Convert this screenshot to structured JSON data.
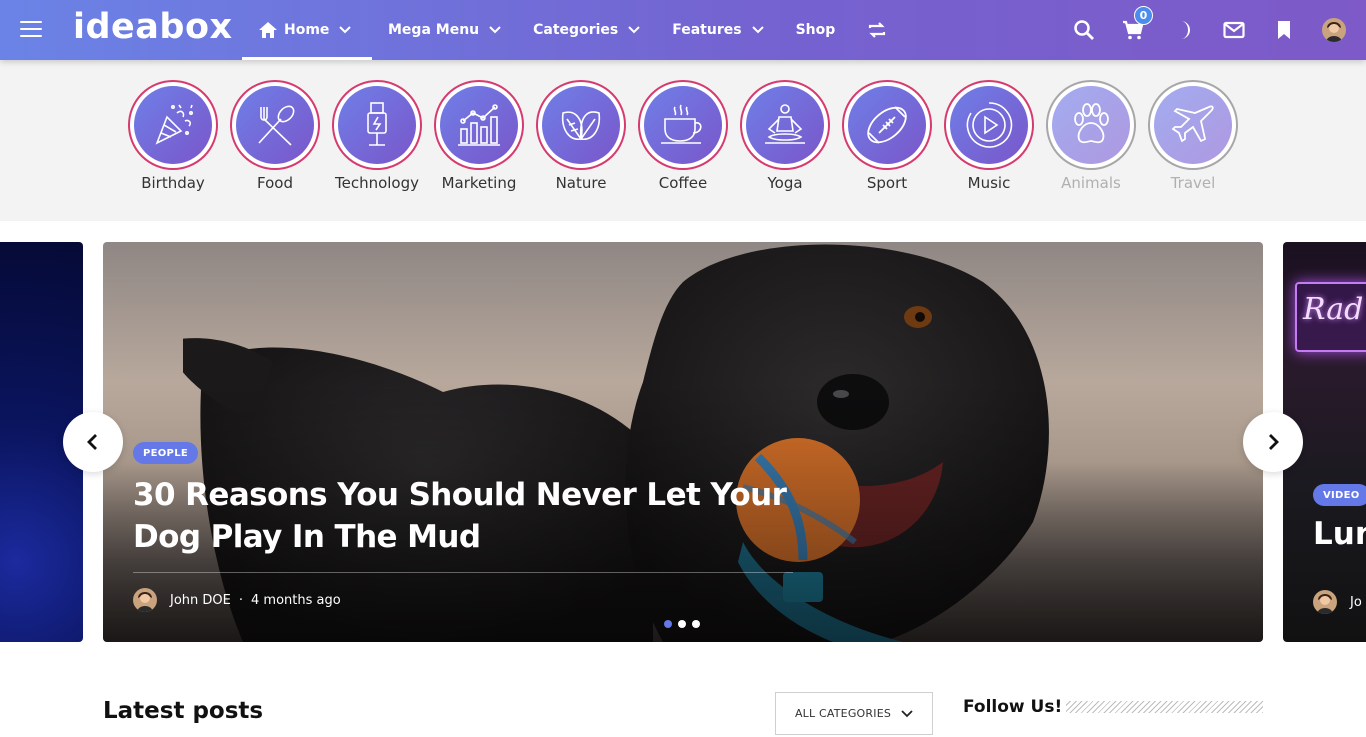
{
  "header": {
    "logo": "ideabox",
    "nav": [
      {
        "label": "Home",
        "has_dropdown": true,
        "active": true
      },
      {
        "label": "Mega Menu",
        "has_dropdown": true
      },
      {
        "label": "Categories",
        "has_dropdown": true
      },
      {
        "label": "Features",
        "has_dropdown": true
      },
      {
        "label": "Shop",
        "has_dropdown": false
      }
    ],
    "cart_count": "0",
    "icons": [
      "menu-icon",
      "home-icon",
      "shuffle-icon",
      "search-icon",
      "cart-icon",
      "dark-mode-icon",
      "mail-icon",
      "bookmark-icon"
    ]
  },
  "categories": [
    {
      "label": "Birthday",
      "icon": "party-popper-icon",
      "faded": false
    },
    {
      "label": "Food",
      "icon": "fork-spoon-icon",
      "faded": false
    },
    {
      "label": "Technology",
      "icon": "usb-plug-icon",
      "faded": false
    },
    {
      "label": "Marketing",
      "icon": "growth-chart-icon",
      "faded": false
    },
    {
      "label": "Nature",
      "icon": "leaves-icon",
      "faded": false
    },
    {
      "label": "Coffee",
      "icon": "coffee-cup-icon",
      "faded": false
    },
    {
      "label": "Yoga",
      "icon": "meditation-icon",
      "faded": false
    },
    {
      "label": "Sport",
      "icon": "football-icon",
      "faded": false
    },
    {
      "label": "Music",
      "icon": "play-circle-icon",
      "faded": false
    },
    {
      "label": "Animals",
      "icon": "paw-icon",
      "faded": true
    },
    {
      "label": "Travel",
      "icon": "airplane-icon",
      "faded": true
    }
  ],
  "slider": {
    "main": {
      "badge": "PEOPLE",
      "title": "30 Reasons You Should Never Let Your Dog Play In The Mud",
      "author": "John DOE",
      "separator": "·",
      "time": "4 months ago"
    },
    "next": {
      "badge": "VIDEO",
      "title": "Lun",
      "author": "Jo",
      "neon_text": "Rad"
    },
    "dots": 3,
    "active_dot": 1
  },
  "latest": {
    "title": "Latest posts",
    "dropdown_label": "ALL CATEGORIES"
  },
  "sidebar": {
    "follow_title": "Follow Us!"
  },
  "colors": {
    "header_start": "#6b83e6",
    "header_end": "#7d5ac8",
    "accent": "#6478e8",
    "ring": "#d63a6e"
  }
}
